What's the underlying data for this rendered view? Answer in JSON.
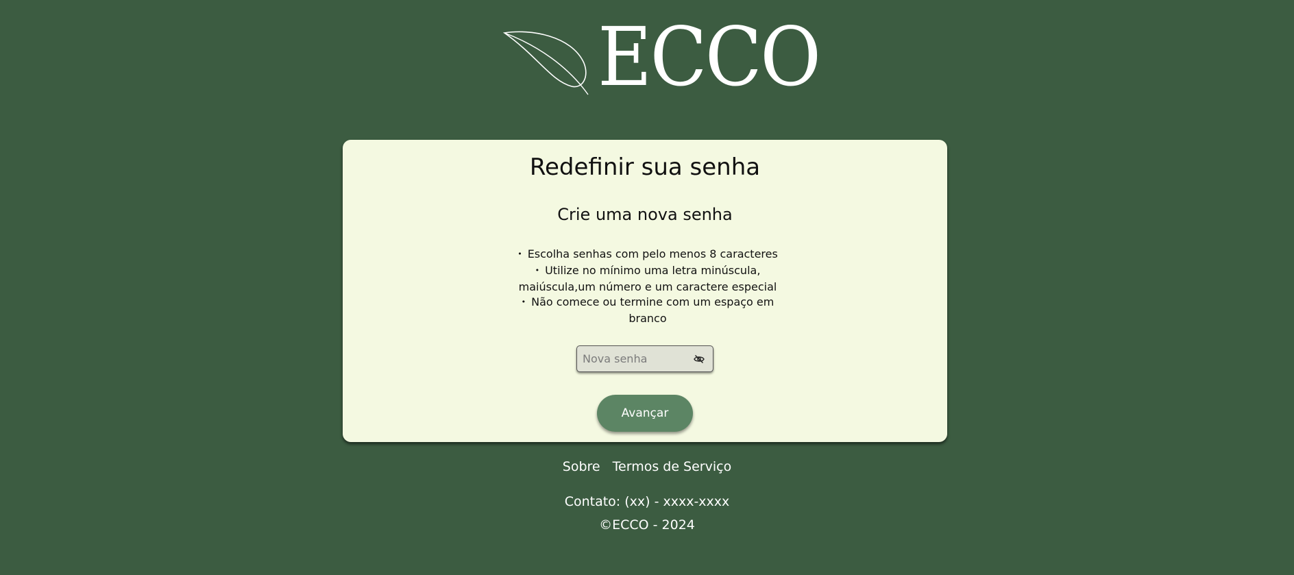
{
  "brand": {
    "logo_text": "ECCO",
    "logo_icon": "leaf-icon"
  },
  "card": {
    "title": "Redefinir sua senha",
    "subtitle": "Crie uma nova senha",
    "rules": [
      "Escolha senhas com pelo menos 8 caracteres",
      "Utilize no mínimo uma letra minúscula, maiúscula,um número e um caractere especial",
      "Não comece ou termine com um espaço em branco"
    ],
    "password_field": {
      "placeholder": "Nova senha",
      "value": "",
      "toggle_icon": "eye-slash-icon"
    },
    "submit_label": "Avançar"
  },
  "footer": {
    "links": {
      "about": "Sobre",
      "terms": "Termos de Serviço"
    },
    "contact": "Contato: (xx) - xxxx-xxxx",
    "copyright": "©ECCO - 2024"
  },
  "colors": {
    "background": "#3c5c41",
    "card": "#f4f9e1",
    "button": "#5c8564"
  }
}
